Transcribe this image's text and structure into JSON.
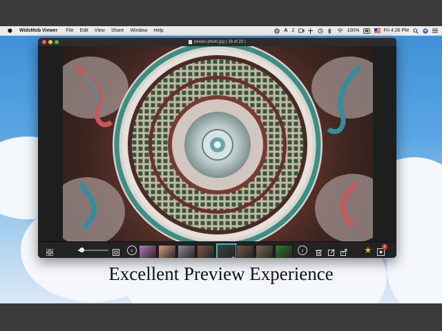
{
  "menubar": {
    "app_name": "WidsMob Viewer",
    "menus": [
      "File",
      "Edit",
      "View",
      "Share",
      "Window",
      "Help"
    ],
    "status": {
      "badge_text": "2",
      "battery": "100%",
      "clock": "Fri 4:26 PM"
    }
  },
  "window": {
    "title": "pexels-photo.jpg ( 26 of 29 )"
  },
  "toolbar": {
    "zoom_level_fraction": 0.12,
    "prev_label": "‹",
    "next_label": "›",
    "selected_thumbnail_index": 4,
    "thumbnail_colors": [
      "#b27bb8",
      "#d89b7a",
      "#8a8c8f",
      "#7a5a48",
      "#3b4242",
      "#6b5a48",
      "#7d6a52",
      "#2f7a2c"
    ],
    "notification_count": "2"
  },
  "caption": {
    "text": "Excellent Preview Experience"
  },
  "colors": {
    "window_bg": "#1e1e1e",
    "selection_accent": "#3fb7c7",
    "star": "#e6b622",
    "sky": "#5aa6e3"
  }
}
